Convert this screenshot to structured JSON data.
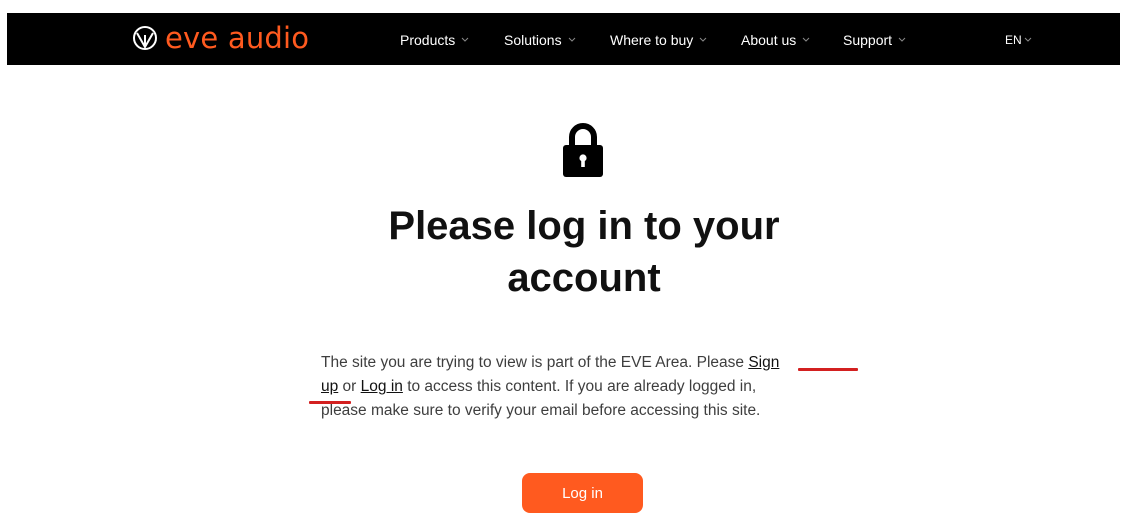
{
  "header": {
    "logo_text": "eve audio",
    "nav": [
      {
        "label": "Products"
      },
      {
        "label": "Solutions"
      },
      {
        "label": "Where to buy"
      },
      {
        "label": "About us"
      },
      {
        "label": "Support"
      }
    ],
    "language": "EN"
  },
  "main": {
    "lock_icon": "lock-icon",
    "heading_line1": "Please log in to your",
    "heading_line2": "account",
    "text_1": "The site you are trying to view is part of the EVE Area. Please ",
    "signup_link_part1": "Sign",
    "signup_link_part2": "up",
    "text_2": " or ",
    "login_link": "Log in",
    "text_3": " to access this content. If you are already logged in,",
    "text_4": "please make sure to verify your email before accessing this site.",
    "login_button": "Log in"
  },
  "colors": {
    "brand": "#ff5a1f",
    "topbar": "#000000",
    "annotation": "#d32020"
  }
}
